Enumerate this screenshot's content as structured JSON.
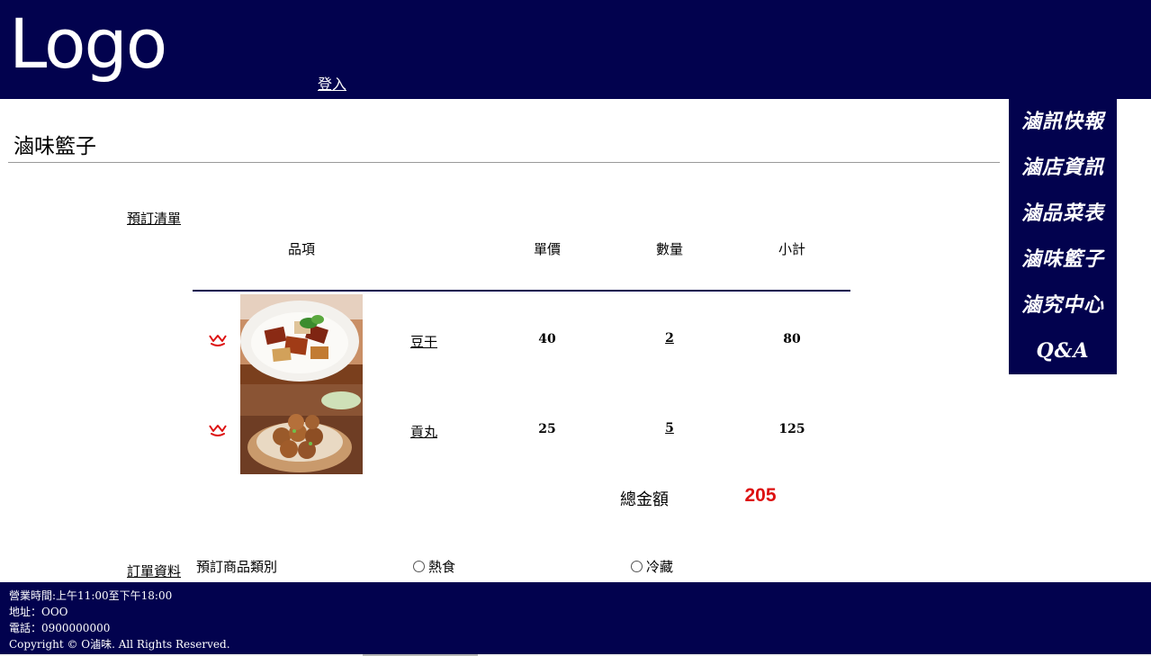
{
  "header": {
    "logo": "Logo",
    "login": "登入"
  },
  "sidenav": {
    "items": [
      "滷訊快報",
      "滷店資訊",
      "滷品菜表",
      "滷味籃子",
      "滷究中心",
      "Q&A"
    ]
  },
  "page": {
    "title": "滷味籃子"
  },
  "sections": {
    "order_list": "預訂清單",
    "order_info": "訂單資料"
  },
  "table": {
    "headers": {
      "item": "品項",
      "price": "單價",
      "qty": "數量",
      "subtotal": "小計"
    },
    "rows": [
      {
        "icon": "remove-basket-icon",
        "image": "tofu-dish-image",
        "name": "豆干",
        "price": "40",
        "qty": "2",
        "subtotal": "80"
      },
      {
        "icon": "remove-basket-icon",
        "image": "meatball-dish-image",
        "name": "貢丸",
        "price": "25",
        "qty": "5",
        "subtotal": "125"
      }
    ],
    "total_label": "總金額",
    "total_value": "205"
  },
  "order": {
    "category_label": "預訂商品類別",
    "options": [
      "熱食",
      "冷藏"
    ]
  },
  "footer": {
    "hours": "營業時間:上午11:00至下午18:00",
    "address": "地址：OOO",
    "phone": "電話：0900000000",
    "copyright": "Copyright © O滷味. All Rights Reserved."
  },
  "colors": {
    "brand_navy": "#02024e",
    "accent_red": "#dd1111",
    "white": "#ffffff"
  }
}
